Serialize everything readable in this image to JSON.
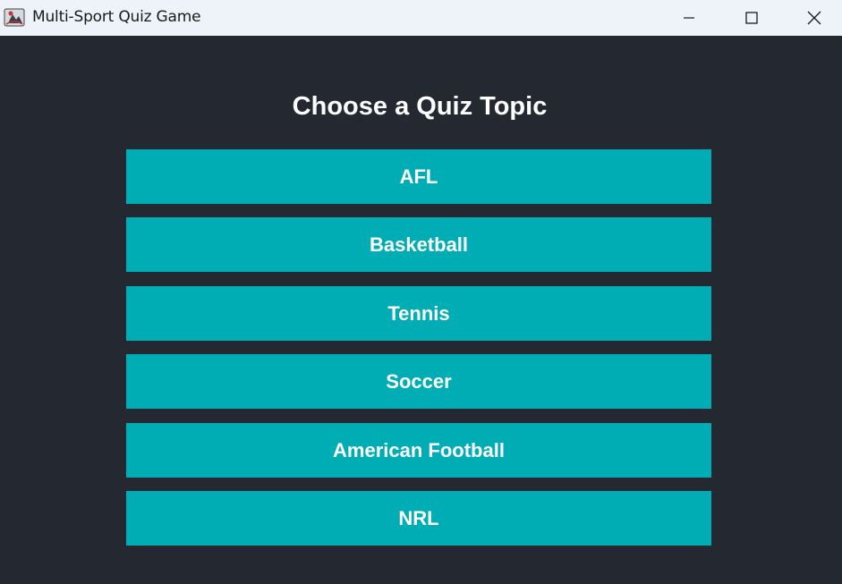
{
  "window": {
    "title": "Multi-Sport Quiz Game",
    "icon": "java-app-icon",
    "controls": [
      "minimize-icon",
      "maximize-icon",
      "close-icon"
    ]
  },
  "main": {
    "heading": "Choose a Quiz Topic",
    "topics": [
      {
        "label": "AFL"
      },
      {
        "label": "Basketball"
      },
      {
        "label": "Tennis"
      },
      {
        "label": "Soccer"
      },
      {
        "label": "American Football"
      },
      {
        "label": "NRL"
      }
    ]
  },
  "colors": {
    "background": "#232831",
    "button": "#00adb5",
    "button_text": "#ffffff",
    "titlebar": "#eef3f9"
  }
}
